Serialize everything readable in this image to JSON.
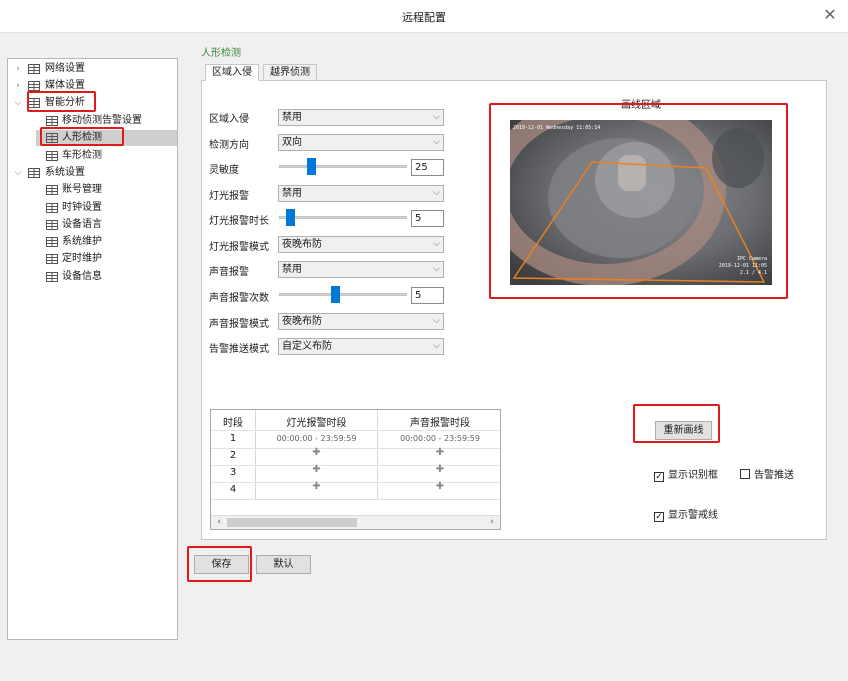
{
  "window": {
    "title": "远程配置"
  },
  "tree": {
    "items": [
      {
        "label": "网络设置",
        "level": 0,
        "expand": "collapsed"
      },
      {
        "label": "媒体设置",
        "level": 0,
        "expand": "collapsed"
      },
      {
        "label": "智能分析",
        "level": 0,
        "expand": "expanded"
      },
      {
        "label": "移动侦测告警设置",
        "level": 1
      },
      {
        "label": "人形检测",
        "level": 1,
        "selected": true
      },
      {
        "label": "车形检测",
        "level": 1
      },
      {
        "label": "系统设置",
        "level": 0,
        "expand": "expanded"
      },
      {
        "label": "账号管理",
        "level": 1
      },
      {
        "label": "时钟设置",
        "level": 1
      },
      {
        "label": "设备语言",
        "level": 1
      },
      {
        "label": "系统维护",
        "level": 1
      },
      {
        "label": "定时维护",
        "level": 1
      },
      {
        "label": "设备信息",
        "level": 1
      }
    ]
  },
  "panel": {
    "group_title": "人形检测",
    "tabs": [
      {
        "label": "区域入侵",
        "active": true
      },
      {
        "label": "越界侦测",
        "active": false
      }
    ]
  },
  "form": {
    "region_intrusion": {
      "label": "区域入侵",
      "value": "禁用"
    },
    "detect_direction": {
      "label": "检测方向",
      "value": "双向"
    },
    "sensitivity": {
      "label": "灵敏度",
      "value": "25"
    },
    "light_alarm": {
      "label": "灯光报警",
      "value": "禁用"
    },
    "light_alarm_duration": {
      "label": "灯光报警时长",
      "value": "5"
    },
    "light_alarm_mode": {
      "label": "灯光报警模式",
      "value": "夜晚布防"
    },
    "sound_alarm": {
      "label": "声音报警",
      "value": "禁用"
    },
    "sound_alarm_count": {
      "label": "声音报警次数",
      "value": "5"
    },
    "sound_alarm_mode": {
      "label": "声音报警模式",
      "value": "夜晚布防"
    },
    "push_mode": {
      "label": "告警推送模式",
      "value": "自定义布防"
    }
  },
  "video": {
    "caption": "画线区域",
    "osd_top": "2019-12-01 Wednesday 11:05:14",
    "osd_bottom_1": "IPC Camera",
    "osd_bottom_2": "2019-12-01 11:05",
    "osd_bottom_3": "2.1 / 4.1",
    "colors": {
      "zone_line": "#e8821e"
    }
  },
  "schedule": {
    "headers": [
      "时段",
      "灯光报警时段",
      "声音报警时段"
    ],
    "rows": [
      {
        "idx": "1",
        "light": "00:00:00 - 23:59:59",
        "sound": "00:00:00 - 23:59:59"
      },
      {
        "idx": "2",
        "light": "",
        "sound": ""
      },
      {
        "idx": "3",
        "light": "",
        "sound": ""
      },
      {
        "idx": "4",
        "light": "",
        "sound": ""
      }
    ]
  },
  "buttons": {
    "redraw": "重新画线",
    "save": "保存",
    "default": "默认"
  },
  "checks": {
    "show_box": {
      "label": "显示识别框",
      "checked": true
    },
    "alarm_push": {
      "label": "告警推送",
      "checked": false
    },
    "show_line": {
      "label": "显示警戒线",
      "checked": true
    }
  },
  "colors": {
    "highlight": "#e0191b",
    "accent": "#0078d7",
    "group_title": "#3a8a3a"
  }
}
